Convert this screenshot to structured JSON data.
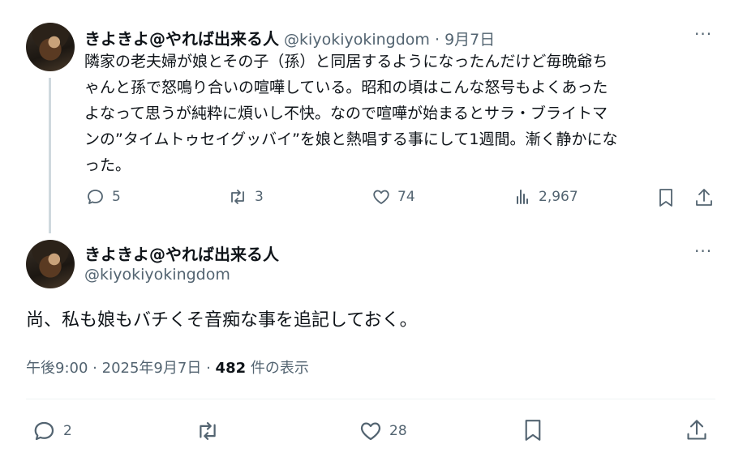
{
  "parent_tweet": {
    "display_name": "きよきよ@やれば出来る人",
    "handle": "@kiyokiyokingdom",
    "separator": "·",
    "date": "9月7日",
    "more": "···",
    "lines": [
      "隣家の老夫婦が娘とその子（孫）と同居するようになったんだけど毎晩爺ち",
      "ゃんと孫で怒鳴り合いの喧嘩している。昭和の頃はこんな怒号もよくあった",
      "よなって思うが純粋に煩いし不快。なので喧嘩が始まるとサラ・ブライトマ",
      "ンの”タイムトゥセイグッバイ”を娘と熱唱する事にして1週間。漸く静かにな",
      "った。"
    ],
    "actions": {
      "replies": "5",
      "reposts": "3",
      "likes": "74",
      "views": "2,967"
    }
  },
  "main_tweet": {
    "display_name": "きよきよ@やれば出来る人",
    "handle": "@kiyokiyokingdom",
    "more": "···",
    "text": "尚、私も娘もバチくそ音痴な事を追記しておく。",
    "time": "午後9:00",
    "dot": "·",
    "date": "2025年9月7日",
    "views_count": "482",
    "views_label": "件の表示",
    "actions": {
      "replies": "2",
      "likes": "28"
    }
  },
  "colors": {
    "text": "#0f1419",
    "muted": "#536471",
    "thread_line": "#cfd9de",
    "divider": "#eff3f4"
  },
  "icons": [
    "reply-icon",
    "repost-icon",
    "like-icon",
    "views-icon",
    "bookmark-icon",
    "share-icon",
    "more-icon"
  ]
}
